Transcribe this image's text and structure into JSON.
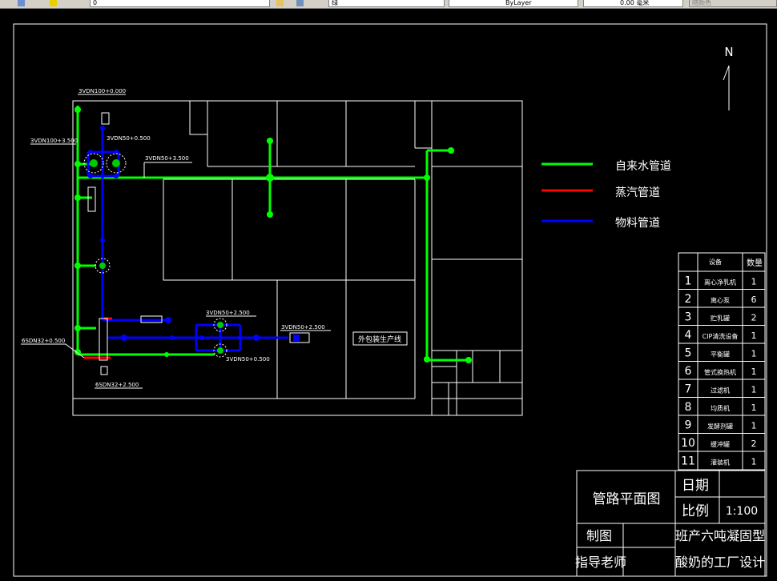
{
  "toolbar": {
    "field1": "0",
    "field2": "绿",
    "field3": "ByLayer",
    "field4": "0.00 毫米",
    "field5": "随颜色"
  },
  "north": "N",
  "legend": [
    {
      "label": "自来水管道",
      "color": "#00ff00"
    },
    {
      "label": "蒸汽管道",
      "color": "#ff0000"
    },
    {
      "label": "物料管道",
      "color": "#0000ff"
    }
  ],
  "pipe_labels": {
    "l1": "3VDN100+0.000",
    "l2": "3VDN100+3.500",
    "l3": "3VDN50+0.500",
    "l4": "3VDN50+3.500",
    "l5": "3VDN50+2.500",
    "l6": "3VDN50+2.500",
    "l7": "3VDN50+0.500",
    "l8": "6SDN32+0.500",
    "l9": "6SDN32+2.500",
    "pack_line": "外包装生产线"
  },
  "equipment_table": {
    "header_equipment": "设备",
    "header_qty": "数量",
    "rows": [
      {
        "no": "1",
        "name": "离心净乳机",
        "qty": "1"
      },
      {
        "no": "2",
        "name": "离心泵",
        "qty": "6"
      },
      {
        "no": "3",
        "name": "贮乳罐",
        "qty": "2"
      },
      {
        "no": "4",
        "name": "CIP清洗设备",
        "qty": "1"
      },
      {
        "no": "5",
        "name": "平衡罐",
        "qty": "1"
      },
      {
        "no": "6",
        "name": "管式换热机",
        "qty": "1"
      },
      {
        "no": "7",
        "name": "过滤机",
        "qty": "1"
      },
      {
        "no": "8",
        "name": "均质机",
        "qty": "1"
      },
      {
        "no": "9",
        "name": "发酵剂罐",
        "qty": "1"
      },
      {
        "no": "10",
        "name": "缓冲罐",
        "qty": "2"
      },
      {
        "no": "11",
        "name": "灌装机",
        "qty": "1"
      }
    ]
  },
  "title_block": {
    "drawing_name": "管路平面图",
    "date_label": "日期",
    "scale_label": "比例",
    "scale_value": "1:100",
    "drawn_by_label": "制图",
    "advisor_label": "指导老师",
    "project_line1": "班产六吨凝固型",
    "project_line2": "酸奶的工厂设计"
  }
}
